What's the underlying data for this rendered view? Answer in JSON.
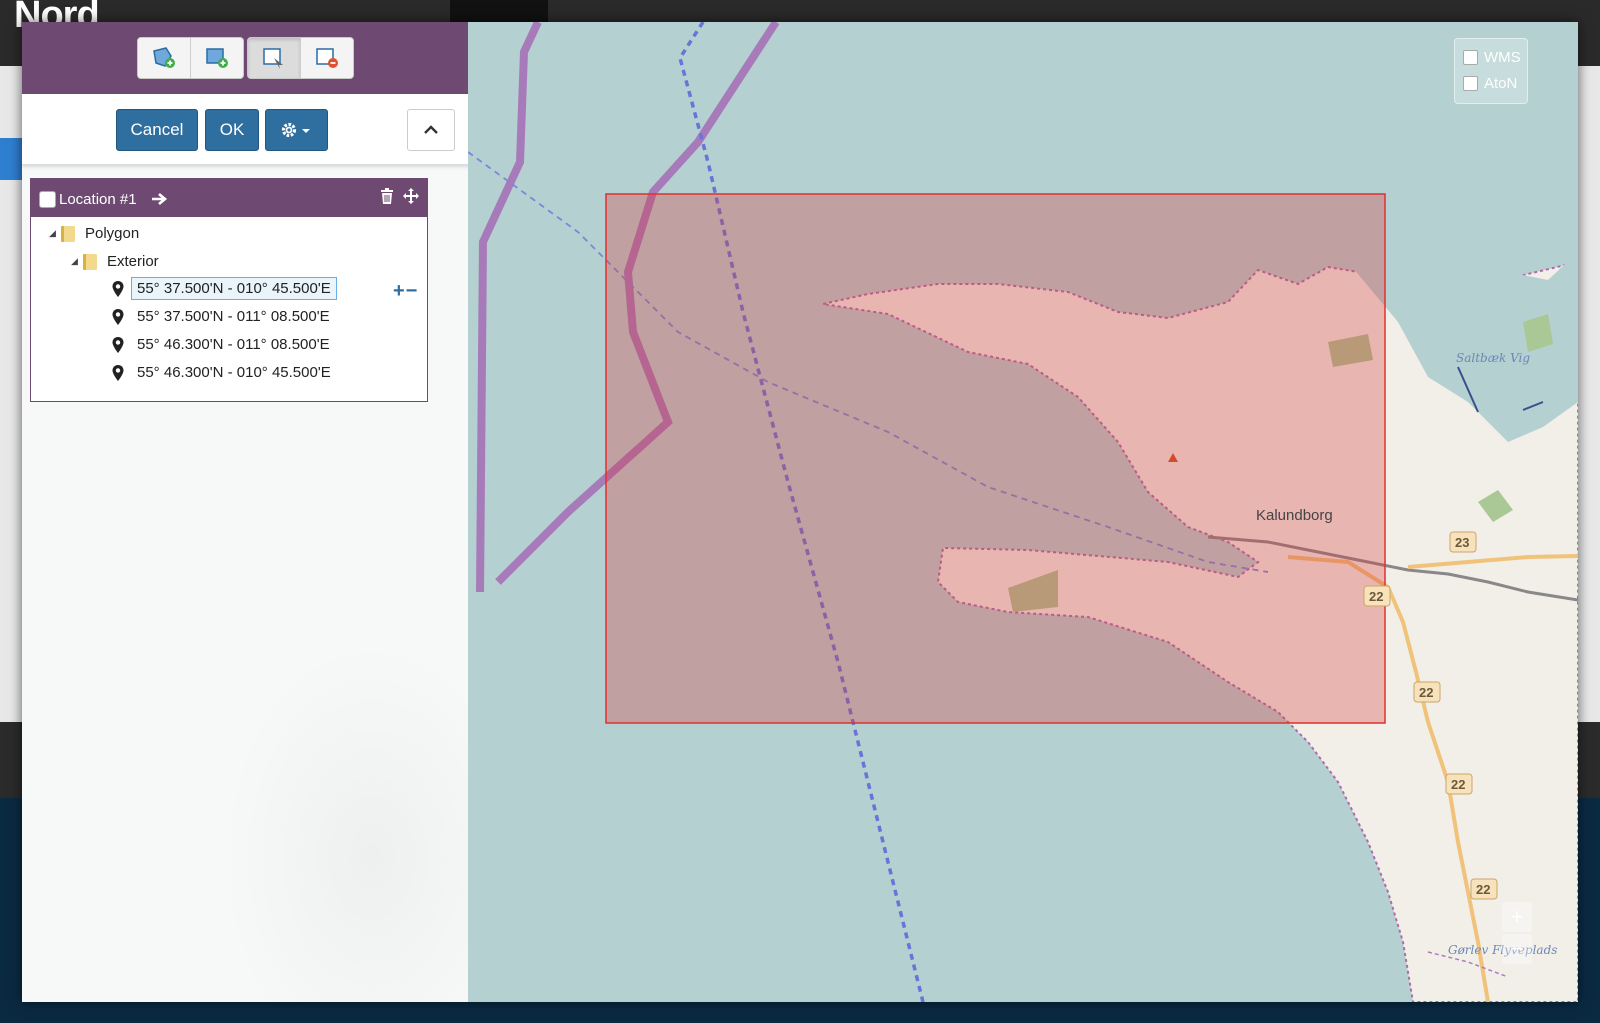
{
  "app": {
    "logo_text": "Nord"
  },
  "toolbar": {
    "tools": [
      {
        "name": "add-polygon-icon"
      },
      {
        "name": "add-rectangle-icon"
      },
      {
        "name": "select-area-icon",
        "active": true
      },
      {
        "name": "remove-area-icon"
      }
    ],
    "cancel_label": "Cancel",
    "ok_label": "OK"
  },
  "location": {
    "title": "Location #1",
    "geometry_label": "Polygon",
    "ring_label": "Exterior",
    "points": [
      "55° 37.500'N - 010° 45.500'E",
      "55° 37.500'N - 011° 08.500'E",
      "55° 46.300'N - 011° 08.500'E",
      "55° 46.300'N - 010° 45.500'E"
    ],
    "add_remove_label": "+−"
  },
  "map": {
    "layers": [
      "WMS",
      "AtoN"
    ],
    "labels": {
      "town": "Kalundborg",
      "bay": "Saltbæk Vig",
      "airfield": "Gørlev Flyveplads"
    },
    "road_numbers": [
      "23",
      "22",
      "22",
      "22",
      "22"
    ],
    "zoom_in": "+",
    "zoom_out": "−",
    "colors": {
      "sea": "#b5d0d0",
      "selection": "#e03030",
      "route": "#a46bb5"
    }
  }
}
